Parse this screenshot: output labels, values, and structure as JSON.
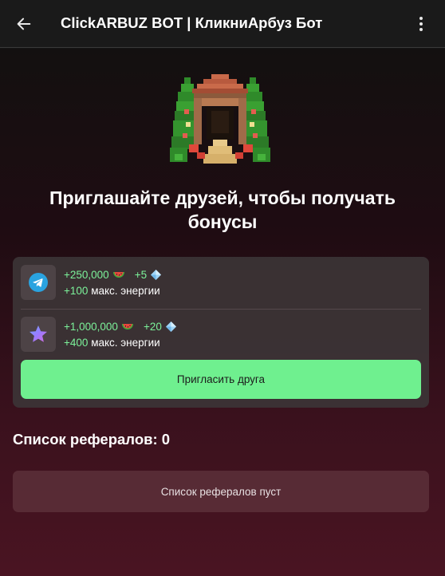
{
  "header": {
    "title": "ClickARBUZ BOT | КликниАрбуз Бот",
    "back_icon": "arrow-left-icon",
    "menu_icon": "more-vertical-icon"
  },
  "hero": {
    "image": "pixel-house-garden-illustration",
    "title": "Приглашайте друзей, чтобы получать бонусы"
  },
  "rewards": [
    {
      "icon": "telegram-icon",
      "coins": "+250,000",
      "coin_icon": "watermelon-icon",
      "gems": "+5",
      "gem_icon": "diamond-icon",
      "energy_value": "+100",
      "energy_label": "макс. энергии"
    },
    {
      "icon": "telegram-premium-star-icon",
      "coins": "+1,000,000",
      "coin_icon": "watermelon-icon",
      "gems": "+20",
      "gem_icon": "diamond-icon",
      "energy_value": "+400",
      "energy_label": "макс. энергии"
    }
  ],
  "invite_button": "Пригласить друга",
  "referrals": {
    "title": "Список рефералов: 0",
    "empty_text": "Список рефералов пуст"
  },
  "colors": {
    "accent_green": "#6ff08f",
    "reward_text_green": "#7cf29a",
    "card_bg": "#3c3436",
    "empty_list_bg": "#5c303a"
  }
}
